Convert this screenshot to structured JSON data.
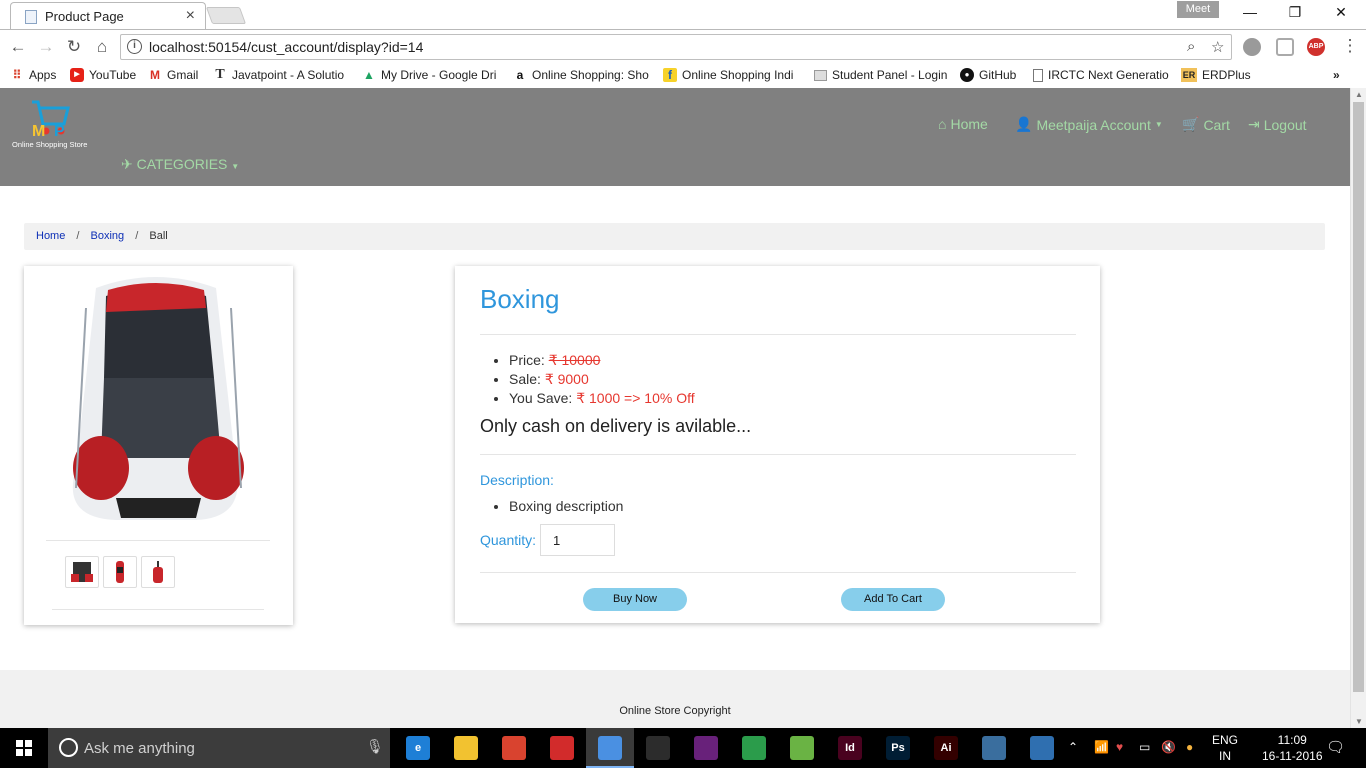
{
  "browser": {
    "tab_title": "Product Page",
    "profile_name": "Meet",
    "url": "localhost:50154/cust_account/display?id=14",
    "bookmarks": [
      {
        "label": "Apps",
        "icon": "apps-grid-icon"
      },
      {
        "label": "YouTube",
        "icon": "youtube-icon"
      },
      {
        "label": "Gmail",
        "icon": "gmail-icon"
      },
      {
        "label": "Javatpoint - A Solutio",
        "icon": "javatpoint-icon"
      },
      {
        "label": "My Drive - Google Dri",
        "icon": "google-drive-icon"
      },
      {
        "label": "Online Shopping: Sho",
        "icon": "amazon-icon"
      },
      {
        "label": "Online Shopping Indi",
        "icon": "flipkart-icon"
      },
      {
        "label": "Student Panel - Login",
        "icon": "student-panel-icon"
      },
      {
        "label": "GitHub",
        "icon": "github-icon"
      },
      {
        "label": "IRCTC Next Generatio",
        "icon": "page-icon"
      },
      {
        "label": "ERDPlus",
        "icon": "erdplus-icon"
      }
    ]
  },
  "site": {
    "logo_text": "Online Shopping Store",
    "nav": {
      "home": "Home",
      "account": "Meetpaija Account",
      "cart": "Cart",
      "logout": "Logout",
      "categories": "CATEGORIES"
    },
    "link_color": "#a3d9a5",
    "nav_bg": "#808080"
  },
  "breadcrumb": {
    "home": "Home",
    "category": "Boxing",
    "current": "Ball"
  },
  "product": {
    "title": "Boxing",
    "price_label": "Price:",
    "price_value": "₹ 10000",
    "sale_label": "Sale:",
    "sale_value": "₹ 9000",
    "save_label": "You Save:",
    "save_value": "₹ 1000 => 10% Off",
    "cod_note": "Only cash on delivery is avilable...",
    "description_label": "Description:",
    "description": "Boxing description",
    "quantity_label": "Quantity:",
    "quantity_value": "1",
    "buy_label": "Buy Now",
    "cart_label": "Add To Cart",
    "title_color": "#2f96dc",
    "price_color": "#e6372f",
    "button_color": "#87ceeb"
  },
  "footer": {
    "text": "Online Store Copyright"
  },
  "taskbar": {
    "search_placeholder": "Ask me anything",
    "lang_top": "ENG",
    "lang_bottom": "IN",
    "time": "11:09",
    "date": "16-11-2016",
    "apps": [
      {
        "icon": "edge-icon",
        "color": "#1e7fd6",
        "glyph": "e"
      },
      {
        "icon": "file-explorer-icon",
        "color": "#f2c230",
        "glyph": ""
      },
      {
        "icon": "acrobat-icon",
        "color": "#d9432f",
        "glyph": ""
      },
      {
        "icon": "reader-icon",
        "color": "#d22b2b",
        "glyph": ""
      },
      {
        "icon": "chrome-icon",
        "color": "#4a90e2",
        "glyph": ""
      },
      {
        "icon": "store-icon",
        "color": "#2c2c2c",
        "glyph": ""
      },
      {
        "icon": "visual-studio-icon",
        "color": "#68217a",
        "glyph": ""
      },
      {
        "icon": "ie-globe-icon",
        "color": "#2b9c4b",
        "glyph": ""
      },
      {
        "icon": "android-studio-icon",
        "color": "#6ab344",
        "glyph": ""
      },
      {
        "icon": "indesign-icon",
        "color": "#49021f",
        "glyph": "Id"
      },
      {
        "icon": "photoshop-icon",
        "color": "#001d34",
        "glyph": "Ps"
      },
      {
        "icon": "illustrator-icon",
        "color": "#330000",
        "glyph": "Ai"
      },
      {
        "icon": "media-player-icon",
        "color": "#3a6e9e",
        "glyph": ""
      },
      {
        "icon": "photos-icon",
        "color": "#2f6fb0",
        "glyph": ""
      }
    ]
  }
}
